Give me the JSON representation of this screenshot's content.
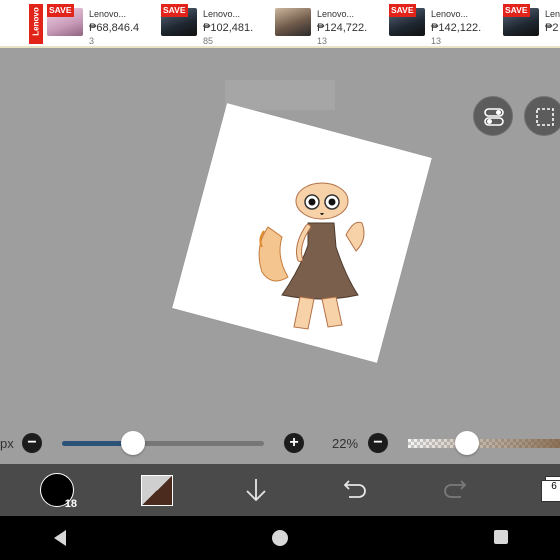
{
  "ad": {
    "brand": "Lenovo",
    "items": [
      {
        "badge": "SAVE",
        "name": "Lenovo...",
        "price": "₱68,846.4",
        "price2": "3"
      },
      {
        "badge": "SAVE",
        "name": "Lenovo...",
        "price": "₱102,481.",
        "price2": "85"
      },
      {
        "badge": "",
        "name": "Lenovo...",
        "price": "₱124,722.",
        "price2": "13"
      },
      {
        "badge": "SAVE",
        "name": "Lenovo...",
        "price": "₱142,122.",
        "price2": "13"
      },
      {
        "badge": "SAVE",
        "name": "Leno",
        "price": "₱2",
        "price2": ""
      }
    ]
  },
  "controls": {
    "size_unit": "px",
    "opacity": "22%",
    "brush_size": "18",
    "layer_count": "6",
    "size_level": 0.35,
    "opacity_level": 0.22
  },
  "icons": {
    "toggle": "toggle-icon",
    "selection": "selection-icon",
    "minus": "−",
    "plus": "+",
    "download": "download-icon",
    "undo": "undo-icon",
    "redo": "redo-icon",
    "back": "back-icon",
    "home": "home-icon",
    "recents": "recents-icon"
  },
  "colors": {
    "accent": "#2b5278",
    "primary_color": "#000000",
    "secondary_color": "#4a2b1d",
    "ad_red": "#e2231a"
  }
}
